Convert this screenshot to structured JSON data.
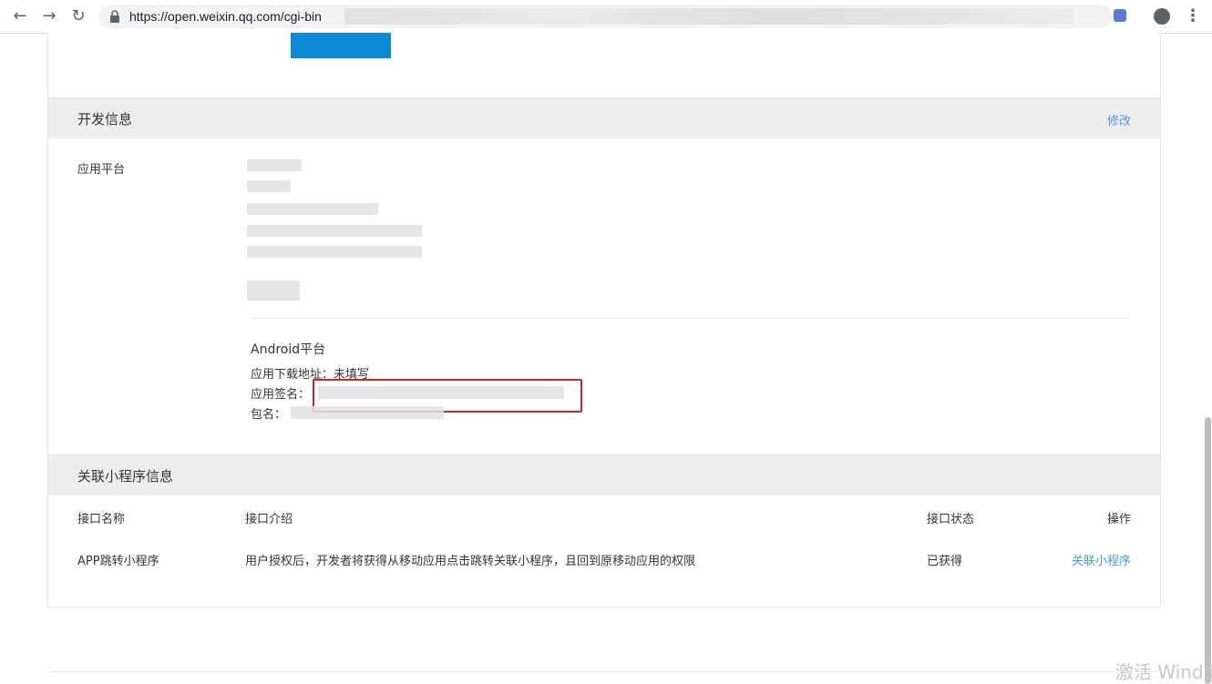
{
  "browser": {
    "url": "https://open.weixin.qq.com/cgi-bin"
  },
  "dev_info": {
    "title": "开发信息",
    "edit": "修改",
    "platform_label": "应用平台",
    "android": {
      "title": "Android平台",
      "download_label": "应用下载地址：",
      "download_value": "未填写",
      "signature_label": "应用签名：",
      "package_label": "包名："
    }
  },
  "mini_program": {
    "title": "关联小程序信息",
    "columns": [
      "接口名称",
      "接口介绍",
      "接口状态",
      "操作"
    ],
    "rows": [
      {
        "name": "APP跳转小程序",
        "desc": "用户授权后，开发者将获得从移动应用点击跳转关联小程序，且回到原移动应用的权限",
        "status": "已获得",
        "action": "关联小程序"
      }
    ]
  },
  "watermark": "激活 Windo",
  "colors": {
    "link": "#459ae9",
    "highlight": "#e02020",
    "accent": "#0d8bd8"
  }
}
